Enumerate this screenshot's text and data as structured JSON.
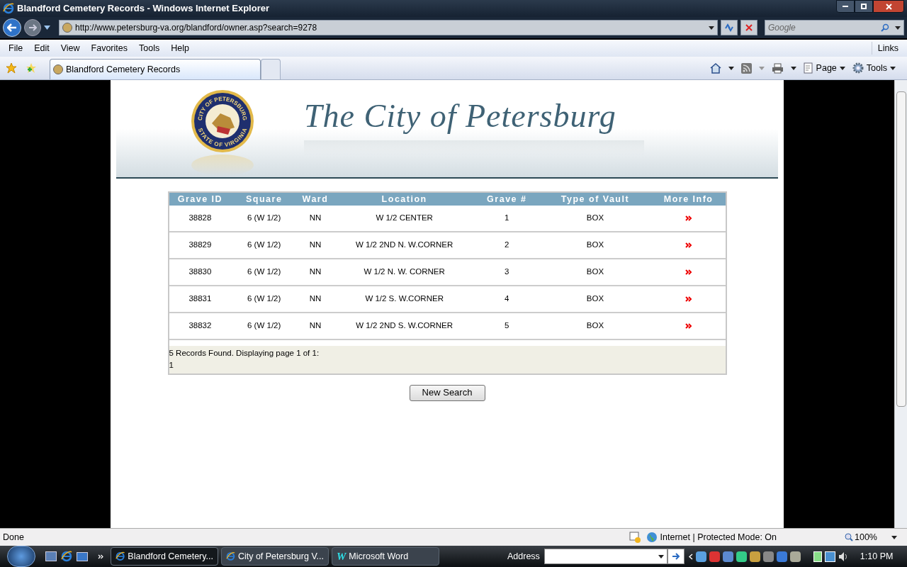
{
  "window": {
    "title": "Blandford Cemetery Records - Windows Internet Explorer"
  },
  "address_bar": {
    "url": "http://www.petersburg-va.org/blandford/owner.asp?search=9278"
  },
  "search": {
    "placeholder": "Google"
  },
  "menu": [
    "File",
    "Edit",
    "View",
    "Favorites",
    "Tools",
    "Help"
  ],
  "links_label": "Links",
  "tabs": [
    {
      "label": "Blandford Cemetery Records",
      "selected": true
    },
    {
      "kind": "new",
      "selected": false
    }
  ],
  "command_bar": {
    "page": "Page",
    "tools": "Tools"
  },
  "banner": {
    "title": "The City of Petersburg",
    "seal_top": "CITY OF PETERSBURG",
    "seal_bottom": "STATE OF VIRGINIA"
  },
  "table": {
    "columns": [
      "Grave ID",
      "Square",
      "Ward",
      "Location",
      "Grave #",
      "Type of Vault",
      "More Info"
    ],
    "rows": [
      {
        "grave_id": "38828",
        "square": "6 (W 1/2)",
        "ward": "NN",
        "location": "W 1/2 CENTER",
        "grave_no": "1",
        "vault": "BOX"
      },
      {
        "grave_id": "38829",
        "square": "6 (W 1/2)",
        "ward": "NN",
        "location": "W 1/2 2ND N. W.CORNER",
        "grave_no": "2",
        "vault": "BOX"
      },
      {
        "grave_id": "38830",
        "square": "6 (W 1/2)",
        "ward": "NN",
        "location": "W 1/2 N. W. CORNER",
        "grave_no": "3",
        "vault": "BOX"
      },
      {
        "grave_id": "38831",
        "square": "6 (W 1/2)",
        "ward": "NN",
        "location": "W 1/2 S. W.CORNER",
        "grave_no": "4",
        "vault": "BOX"
      },
      {
        "grave_id": "38832",
        "square": "6 (W 1/2)",
        "ward": "NN",
        "location": "W 1/2 2ND S. W.CORNER",
        "grave_no": "5",
        "vault": "BOX"
      }
    ],
    "footer": "5 Records Found. Displaying page 1 of 1:",
    "page_link": "1"
  },
  "new_search_button": "New Search",
  "status_bar": {
    "text": "Done",
    "zone": "Internet | Protected Mode: On",
    "zoom": "100%"
  },
  "taskbar": {
    "buttons": [
      {
        "label": "Blandford Cemetery...",
        "kind": "ie",
        "selected": true
      },
      {
        "label": "City of Petersburg V...",
        "kind": "ie",
        "selected": false
      },
      {
        "label": "Microsoft Word",
        "kind": "word",
        "icon_text": "W",
        "selected": false
      }
    ],
    "address_label": "Address",
    "clock": "1:10 PM"
  }
}
